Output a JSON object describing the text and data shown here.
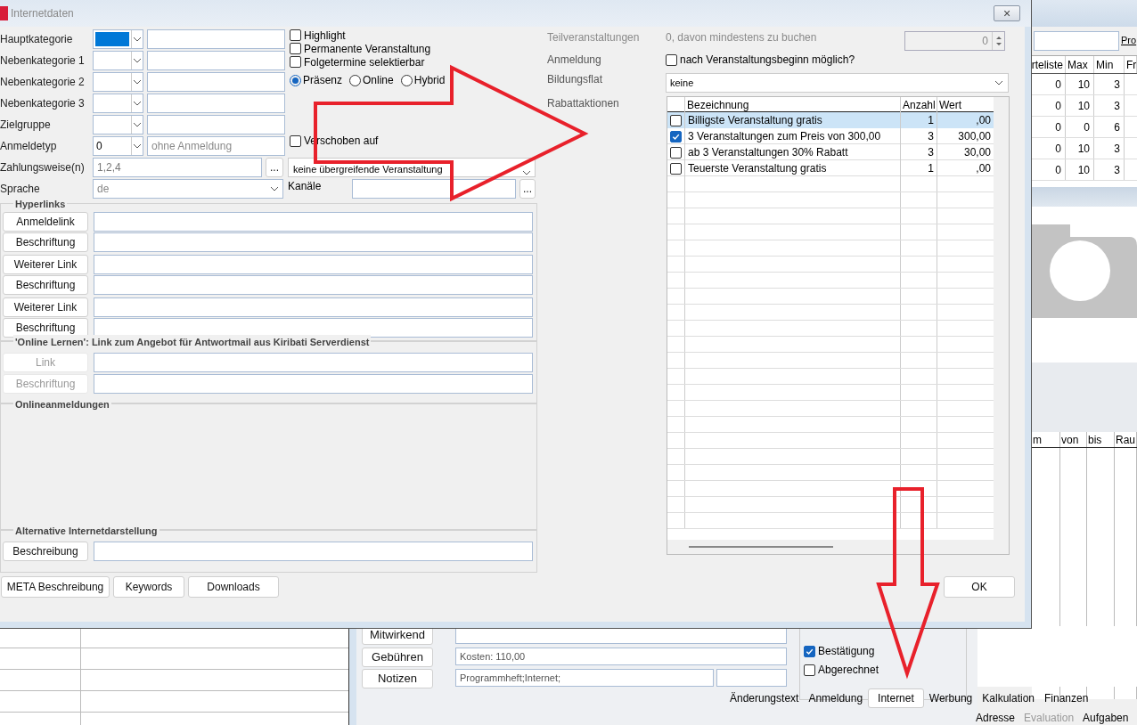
{
  "window": {
    "title": "Internetdaten",
    "close": "×"
  },
  "category_rows": [
    {
      "label": "Hauptkategorie",
      "focused": true
    },
    {
      "label": "Nebenkategorie 1",
      "focused": false
    },
    {
      "label": "Nebenkategorie 2",
      "focused": false
    },
    {
      "label": "Nebenkategorie 3",
      "focused": false
    },
    {
      "label": "Zielgruppe",
      "focused": false
    },
    {
      "label": "Anmeldetyp",
      "code": "0",
      "text": "ohne Anmeldung",
      "focused": false
    }
  ],
  "options": [
    {
      "label": "Highlight",
      "checked": false
    },
    {
      "label": "Permanente Veranstaltung",
      "checked": false
    },
    {
      "label": "Folgetermine selektierbar",
      "checked": false
    }
  ],
  "attendance": [
    {
      "label": "Präsenz",
      "selected": true
    },
    {
      "label": "Online",
      "selected": false
    },
    {
      "label": "Hybrid",
      "selected": false
    }
  ],
  "postponed": {
    "label": "Verschoben auf",
    "checked": false
  },
  "payment": {
    "label": "Zahlungsweise(n)",
    "value": "1,2,4",
    "button": "..."
  },
  "parent_event": {
    "value": "keine übergreifende Veranstaltung"
  },
  "language": {
    "label": "Sprache",
    "value": "de"
  },
  "channels": {
    "label": "Kanäle",
    "button": "..."
  },
  "hyperlinks": {
    "title": "Hyperlinks",
    "buttons": [
      {
        "label": "Anmeldelink"
      },
      {
        "label": "Beschriftung"
      },
      {
        "label": "Weiterer Link"
      },
      {
        "label": "Beschriftung"
      },
      {
        "label": "Weiterer Link"
      },
      {
        "label": "Beschriftung"
      }
    ]
  },
  "online_learning": {
    "title": "'Online Lernen': Link zum Angebot für Antwortmail aus Kiribati Serverdienst",
    "buttons": [
      {
        "label": "Link",
        "disabled": true
      },
      {
        "label": "Beschriftung",
        "disabled": true
      }
    ]
  },
  "online_registrations": {
    "title": "Onlineanmeldungen"
  },
  "alternative": {
    "title": "Alternative Internetdarstellung",
    "button": "Beschreibung"
  },
  "footer_buttons": [
    "META Beschreibung",
    "Keywords",
    "Downloads"
  ],
  "sub_events": {
    "label": "Teilveranstaltungen",
    "text": "0, davon mindestens zu buchen",
    "value": "0"
  },
  "registration": {
    "label": "Anmeldung",
    "option": "nach Veranstaltungsbeginn möglich?",
    "checked": false
  },
  "education_flat": {
    "label": "Bildungsflat",
    "value": "keine"
  },
  "discounts": {
    "label": "Rabattaktionen",
    "columns": [
      "Bezeichnung",
      "Anzahl",
      "Wert"
    ],
    "rows": [
      {
        "name": "Billigste Veranstaltung gratis",
        "count": "1",
        "value": ",00",
        "checked": false,
        "selected": true
      },
      {
        "name": "3 Veranstaltungen zum Preis von 300,00",
        "count": "3",
        "value": "300,00",
        "checked": true,
        "selected": false
      },
      {
        "name": "ab 3 Veranstaltungen 30% Rabatt",
        "count": "3",
        "value": "30,00",
        "checked": false,
        "selected": false
      },
      {
        "name": "Teuerste Veranstaltung gratis",
        "count": "1",
        "value": ",00",
        "checked": false,
        "selected": false
      }
    ]
  },
  "ok_button": "OK",
  "background": {
    "search_label": "Pro",
    "table": {
      "columns": [
        "rteliste",
        "Max",
        "Min",
        "Fr"
      ],
      "rows": [
        [
          "0",
          "10",
          "3"
        ],
        [
          "0",
          "10",
          "3"
        ],
        [
          "0",
          "0",
          "6"
        ],
        [
          "0",
          "10",
          "3"
        ],
        [
          "0",
          "10",
          "3"
        ]
      ]
    },
    "schedule_columns": [
      "m",
      "von",
      "bis",
      "Rau"
    ],
    "side_buttons": [
      "Mitwirkend",
      "Gebühren",
      "Notizen"
    ],
    "fields": [
      "Kosten: 110,00",
      "Programmheft;Internet;"
    ],
    "checks": [
      {
        "label": "Bestätigung",
        "checked": true
      },
      {
        "label": "Abgerechnet",
        "checked": false
      }
    ],
    "tabs": [
      {
        "label": "Änderungstext",
        "selected": false
      },
      {
        "label": "Anmeldung",
        "selected": false
      },
      {
        "label": "Internet",
        "selected": true
      },
      {
        "label": "Werbung",
        "selected": false
      },
      {
        "label": "Kalkulation",
        "selected": false
      },
      {
        "label": "Finanzen",
        "selected": false
      }
    ],
    "tabs_row2": [
      {
        "label": "Adresse",
        "disabled": false
      },
      {
        "label": "Evaluation",
        "disabled": true
      },
      {
        "label": "Aufgaben",
        "disabled": false
      }
    ]
  }
}
